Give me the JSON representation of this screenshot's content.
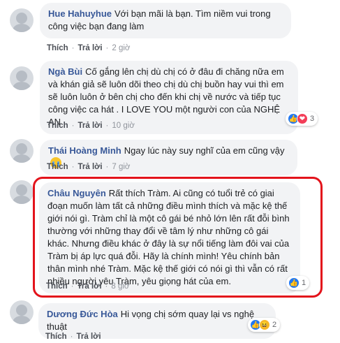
{
  "comments": [
    {
      "name": "Hue Hahuyhue",
      "text": "Với bạn mãi là bạn. Tìm niềm vui trong công việc bạn đang làm",
      "like_label": "Thích",
      "reply_label": "Trả lời",
      "time": "2 giờ"
    },
    {
      "name": "Ngà Bùi",
      "text": "Cố gắng lên chị dù chị có ở đâu đi chăng nữa em và khán giả sẽ luôn dõi theo chị dù chị buồn hay vui thì em sẽ luôn luôn ở bên chị cho đến khi chị về nước và tiếp tục công việc ca hát . I LOVE YOU một người con của NGHỆ AN",
      "like_label": "Thích",
      "reply_label": "Trả lời",
      "time": "10 giờ",
      "reaction_count": "3"
    },
    {
      "name": "Thái Hoàng Minh",
      "text": "Ngay lúc này suy nghĩ của em cũng vậy",
      "like_label": "Thích",
      "reply_label": "Trả lời",
      "time": "7 giờ",
      "emoji": "crying-face"
    },
    {
      "name": "Châu Nguyên",
      "text": "Rất thích Tràm. Ai cũng có tuổi trẻ có giai đoạn muốn làm tất cả những điều mình thích và mặc kệ thế giới nói gì. Tràm chỉ là một cô gái bé nhỏ lớn lên rất đỗi bình thường với những thay đổi về tâm lý như những cô gái khác. Nhưng điều khác ở đây là sự nổi tiếng làm đôi vai của Tràm bị áp lực quá đỗi. Hãy là chính mình! Yêu chính bản thân mình nhé Tràm. Mặc kệ thế giới có nói gì thì vẫn có rất nhiều người yêu Tràm, yêu giọng hát của em.",
      "like_label": "Thích",
      "reply_label": "Trả lời",
      "time": "8 giờ",
      "reaction_count": "1"
    },
    {
      "name": "Dương Đức Hòa",
      "text": "Hi vọng chị sớm quay lại vs nghệ thuật",
      "like_label": "Thích",
      "reply_label": "Trả lời",
      "time": "",
      "reaction_count": "2"
    }
  ],
  "colors": {
    "name": "#385898",
    "bubble": "#f2f3f5",
    "highlight_border": "#e3131b",
    "like": "#2078f4",
    "love": "#f33e58"
  }
}
